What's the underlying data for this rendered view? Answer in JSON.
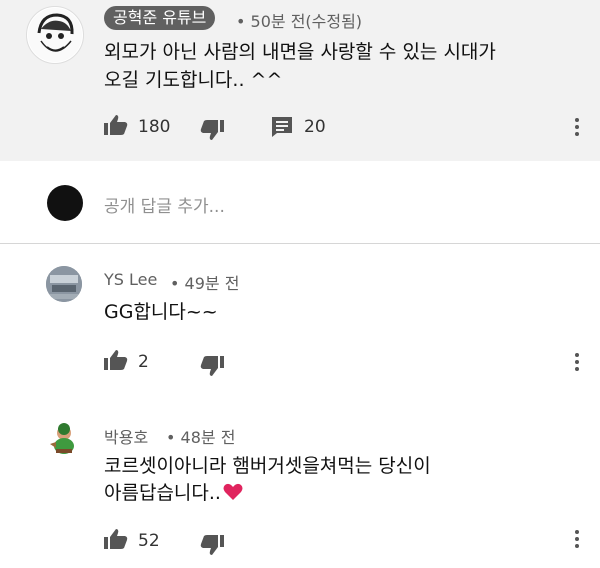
{
  "top_comment": {
    "channel_chip": "공혁준 유튜브",
    "meta": "• 50분 전(수정됨)",
    "text_lines": [
      "외모가 아닌 사람의 내면을 사랑할 수 있는 시대가",
      "오길 기도합니다.. ^^"
    ],
    "likes": "180",
    "replies": "20"
  },
  "reply_box": {
    "placeholder": "공개 답글 추가..."
  },
  "replies": [
    {
      "author": "YS Lee",
      "time": "• 49분 전",
      "text_lines": [
        "GG합니다~~"
      ],
      "likes": "2"
    },
    {
      "author": "박용호",
      "time": "• 48분 전",
      "text_lines": [
        "코르셋이아니라 햄버거셋을쳐먹는 당신이",
        "아름답습니다.."
      ],
      "likes": "52"
    }
  ],
  "colors": {
    "chip_bg": "#606060",
    "heart": "#e0245e",
    "top_bg": "#f2f2f2"
  }
}
